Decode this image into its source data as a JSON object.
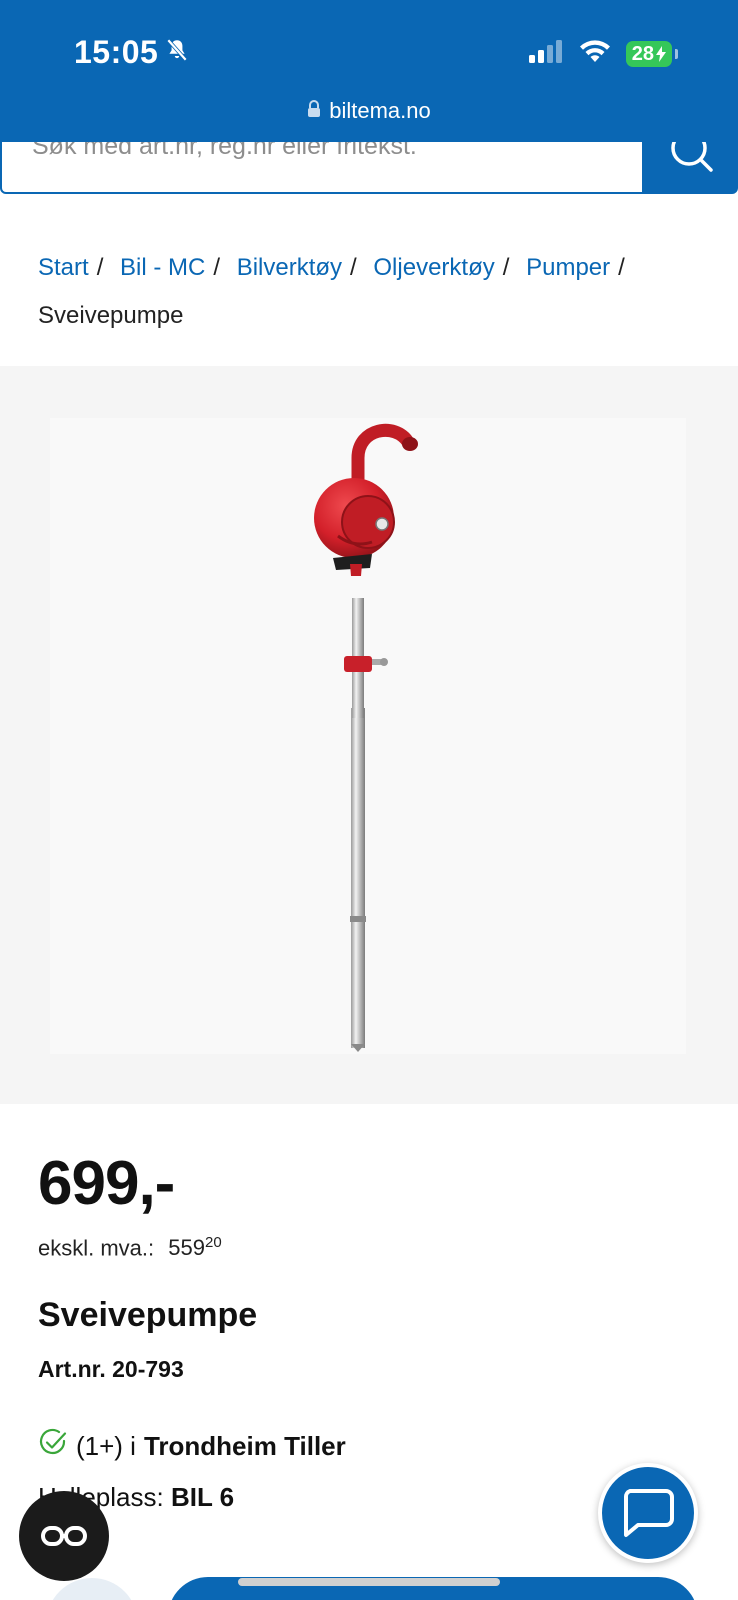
{
  "status_bar": {
    "time": "15:05",
    "battery": "28",
    "mute_icon": "bell-slash-icon",
    "signal_icon": "cellular-signal-icon",
    "wifi_icon": "wifi-icon"
  },
  "browser": {
    "url": "biltema.no",
    "lock_icon": "lock-icon"
  },
  "search": {
    "placeholder": "Søk med art.nr, reg.nr eller fritekst.",
    "button_icon": "search-icon"
  },
  "breadcrumb": {
    "items": [
      "Start",
      "Bil - MC",
      "Bilverktøy",
      "Oljeverktøy",
      "Pumper"
    ],
    "separator": "/",
    "current": "Sveivepumpe"
  },
  "product": {
    "image_subject": "rotary-drum-pump",
    "price": "699,-",
    "ex_vat_label": "ekskl. mva.:",
    "ex_vat_main": "559",
    "ex_vat_cents": "20",
    "title": "Sveivepumpe",
    "art_nr": "Art.nr. 20-793",
    "stock_count": "(1+) i",
    "stock_store": "Trondheim Tiller",
    "shelf_label": "Hylleplass:",
    "shelf_value": "BIL 6"
  },
  "floating": {
    "read_icon": "glasses-icon",
    "chat_icon": "chat-bubble-icon"
  },
  "colors": {
    "brand_blue": "#0a67b4",
    "stock_green": "#3aa63a",
    "pump_red": "#d3202a"
  }
}
